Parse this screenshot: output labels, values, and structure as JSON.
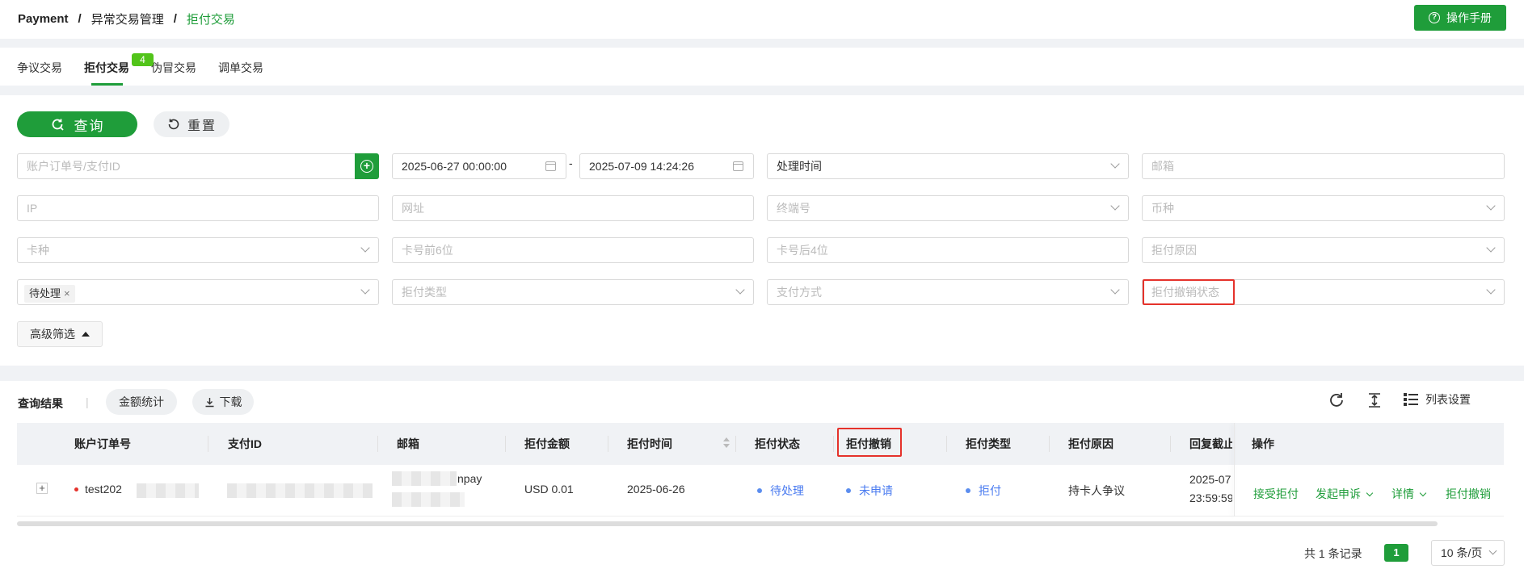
{
  "breadcrumb": [
    "Payment",
    "异常交易管理",
    "拒付交易"
  ],
  "breadcrumb_sep": "/",
  "manual_button": "操作手册",
  "tabs": [
    {
      "label": "争议交易",
      "active": false
    },
    {
      "label": "拒付交易",
      "active": true,
      "badge": "4"
    },
    {
      "label": "伪冒交易",
      "active": false
    },
    {
      "label": "调单交易",
      "active": false
    }
  ],
  "filter": {
    "query_button": "查询",
    "reset_button": "重置",
    "order_placeholder": "账户订单号/支付ID",
    "date_start": "2025-06-27 00:00:00",
    "date_sep": "-",
    "date_end": "2025-07-09 14:24:26",
    "time_type": "处理时间",
    "email_placeholder": "邮箱",
    "ip_placeholder": "IP",
    "url_placeholder": "网址",
    "terminal_placeholder": "终端号",
    "currency_placeholder": "币种",
    "card_type_placeholder": "卡种",
    "card_first6_placeholder": "卡号前6位",
    "card_last4_placeholder": "卡号后4位",
    "reason_placeholder": "拒付原因",
    "status_tag": "待处理",
    "chargeback_type_placeholder": "拒付类型",
    "pay_method_placeholder": "支付方式",
    "revoke_status_placeholder": "拒付撤销状态",
    "advanced_button": "高级筛选"
  },
  "results": {
    "title": "查询结果",
    "separator": "|",
    "amount_stats_button": "金额统计",
    "download_button": "下载",
    "column_settings": "列表设置",
    "columns": [
      "账户订单号",
      "支付ID",
      "邮箱",
      "拒付金额",
      "拒付时间",
      "拒付状态",
      "拒付撤销",
      "拒付类型",
      "拒付原因",
      "回复截止",
      "操作"
    ],
    "row": {
      "expand": "+",
      "order_no": "test202",
      "email_suffix": "npay",
      "amount": "USD 0.01",
      "time": "2025-06-26",
      "status": "待处理",
      "revoke": "未申请",
      "type": "拒付",
      "reason": "持卡人争议",
      "deadline_line1": "2025-07",
      "deadline_line2": "23:59:59"
    },
    "operations": [
      "接受拒付",
      "发起申诉",
      "详情",
      "拒付撤销"
    ],
    "pagination": {
      "total": "共 1 条记录",
      "page": "1",
      "page_size": "10 条/页"
    }
  },
  "colors": {
    "brand": "#1f9d3a",
    "highlight": "#e5322b",
    "status_blue": "#4a7bf0"
  }
}
